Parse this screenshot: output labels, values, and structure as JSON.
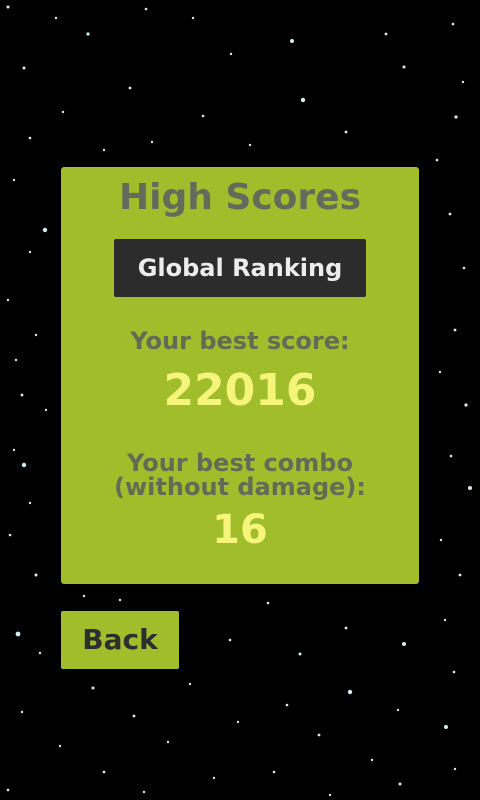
{
  "screen": {
    "background_color": "#000000",
    "panel_color": "#a2bd2c",
    "label_color": "#666a5a",
    "value_color": "#f4f57a"
  },
  "high_scores": {
    "title": "High Scores",
    "global_ranking_label": "Global Ranking",
    "best_score_label": "Your best score:",
    "best_score_value": "22016",
    "best_combo_label_line1": "Your best combo",
    "best_combo_label_line2": "(without damage):",
    "best_combo_value": "16"
  },
  "navigation": {
    "back_label": "Back"
  }
}
